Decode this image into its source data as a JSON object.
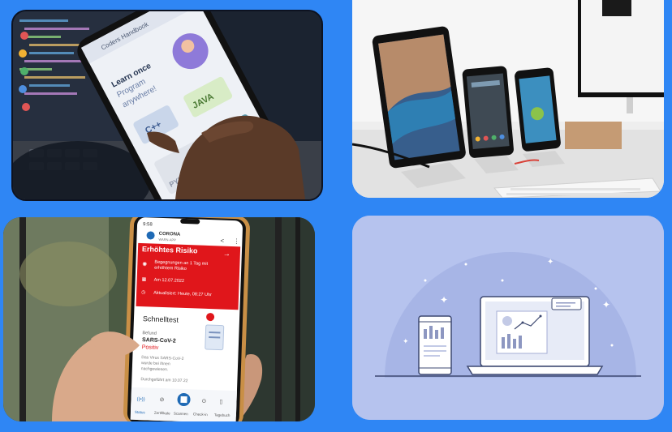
{
  "tile1": {
    "app_title": "Coders Handbook",
    "headline_1": "Learn once",
    "headline_2": "Program",
    "headline_3": "anywhere!",
    "card_cpp": "C++",
    "card_java": "JAVA",
    "card_python": "PYTHON"
  },
  "tile3": {
    "status_time": "9:58",
    "app_name_1": "CORONA",
    "app_name_2": "WARN-APP",
    "risk_title": "Erhöhtes Risiko",
    "risk_line_1": "Begegnungen an 1 Tag mit",
    "risk_line_2": "erhöhtem Risiko",
    "risk_date": "Am 12.07.2022",
    "risk_updated": "Aktualisiert: Heute, 08:27 Uhr",
    "test_title": "Schnelltest",
    "test_label": "Befund",
    "test_virus": "SARS-CoV-2",
    "test_result": "Positiv",
    "test_note_1": "Das Virus SARS-CoV-2",
    "test_note_2": "wurde bei Ihnen",
    "test_note_3": "nachgewiesen.",
    "test_done": "Durchgeführt am 10.07.22",
    "nav": [
      "Status",
      "Zertifikate",
      "Scannen",
      "Check-in",
      "Tagebuch"
    ]
  },
  "colors": {
    "page_bg": "#2f86f4",
    "warn_red": "#e0161b",
    "illustration_bg": "#b6c3ee",
    "illustration_ink": "#3d4870"
  },
  "icons": [
    "share-icon",
    "more-vert-icon",
    "virus-icon",
    "calendar-icon",
    "clock-icon",
    "test-document-icon",
    "scan-qr-icon",
    "location-pin-icon",
    "diary-icon",
    "sparkle-icon"
  ]
}
